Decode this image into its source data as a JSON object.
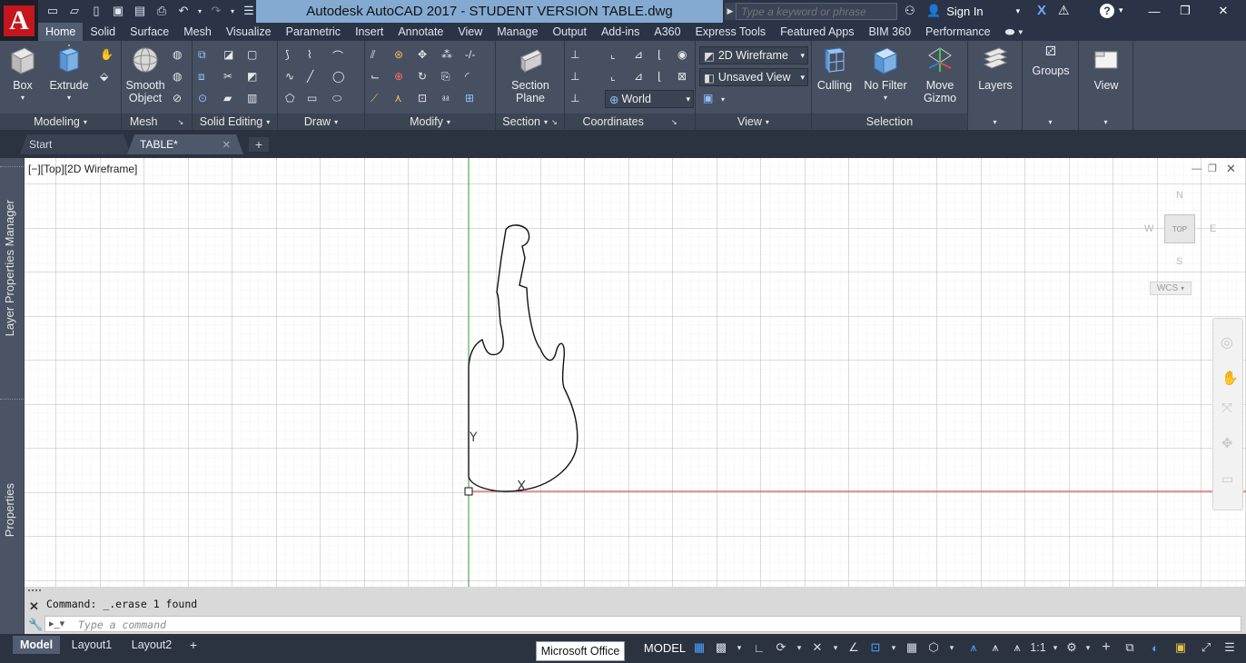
{
  "app": {
    "title": "Autodesk AutoCAD 2017 - STUDENT VERSION    TABLE.dwg",
    "logo_letter": "A",
    "search_placeholder": "Type a keyword or phrase",
    "sign_in": "Sign In"
  },
  "ribbon_tabs": [
    "Home",
    "Solid",
    "Surface",
    "Mesh",
    "Visualize",
    "Parametric",
    "Insert",
    "Annotate",
    "View",
    "Manage",
    "Output",
    "Add-ins",
    "A360",
    "Express Tools",
    "Featured Apps",
    "BIM 360",
    "Performance"
  ],
  "ribbon": {
    "buttons": {
      "box": "Box",
      "extrude": "Extrude",
      "smooth_object_1": "Smooth",
      "smooth_object_2": "Object",
      "section_plane_1": "Section",
      "section_plane_2": "Plane",
      "culling": "Culling",
      "no_filter": "No Filter",
      "move_gizmo_1": "Move",
      "move_gizmo_2": "Gizmo",
      "layers": "Layers",
      "groups": "Groups",
      "view": "View"
    },
    "combos": {
      "visual_style": "2D Wireframe",
      "named_view": "Unsaved View",
      "ucs": "World"
    },
    "panels": {
      "modeling": "Modeling",
      "mesh": "Mesh",
      "solid_editing": "Solid Editing",
      "draw": "Draw",
      "modify": "Modify",
      "section": "Section",
      "coordinates": "Coordinates",
      "view": "View",
      "selection": "Selection"
    }
  },
  "doc_tabs": {
    "start": "Start",
    "table": "TABLE*"
  },
  "palettes": {
    "layer_manager": "Layer Properties Manager",
    "properties": "Properties"
  },
  "viewport": {
    "label": "[−][Top][2D Wireframe]",
    "viewcube": {
      "face": "TOP",
      "north": "N",
      "south": "S",
      "east": "E",
      "west": "W",
      "wcs": "WCS"
    },
    "ucs_y": "Y",
    "ucs_x": "X"
  },
  "command": {
    "history": "Command: _.erase 1 found",
    "placeholder": "Type a command"
  },
  "status": {
    "layout_tabs": [
      "Model",
      "Layout1",
      "Layout2"
    ],
    "model": "MODEL",
    "scale": "1:1",
    "tooltip": "Microsoft Office"
  }
}
